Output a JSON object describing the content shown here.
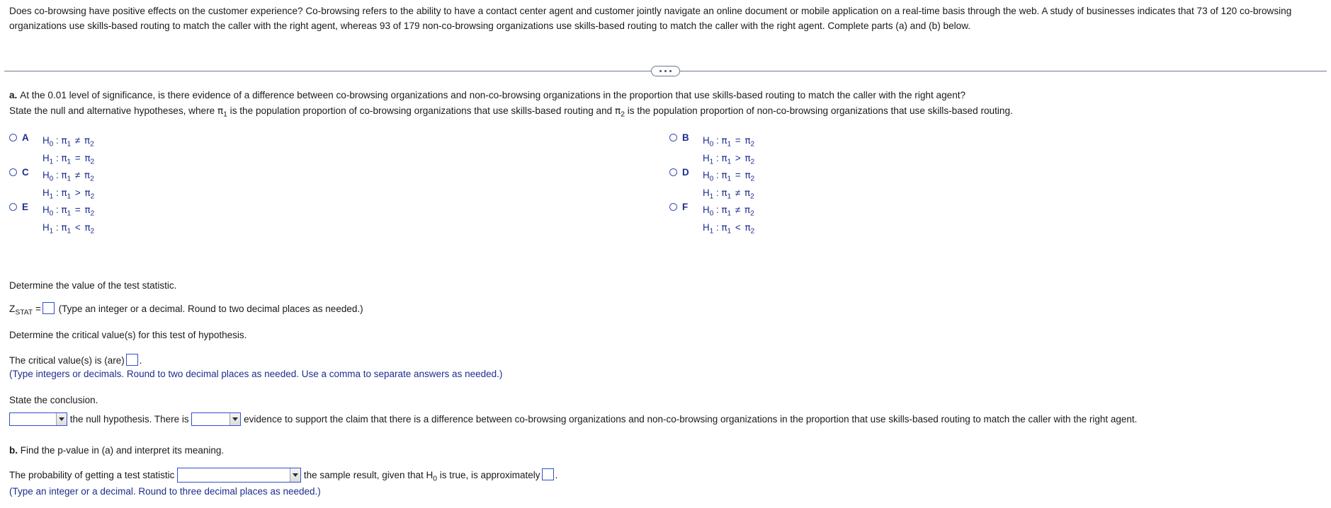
{
  "problem": {
    "text": "Does co-browsing have positive effects on the customer experience? Co-browsing refers to the ability to have a contact center agent and customer jointly navigate an online document or mobile application on a real-time basis through the web. A study of businesses indicates that 73 of 120 co-browsing organizations use skills-based routing to match the caller with the right agent, whereas 93 of 179 non-co-browsing organizations use skills-based routing to match the caller with the right agent. Complete parts (a) and (b) below.",
    "stats": {
      "cobrowsing_successes": 73,
      "cobrowsing_total": 120,
      "noncobrowsing_successes": 93,
      "noncobrowsing_total": 179
    }
  },
  "divider": {
    "ellipsis_label": "more-options"
  },
  "part_a": {
    "label": "a.",
    "question": "At the 0.01 level of significance, is there evidence of a difference between co-browsing organizations and non-co-browsing organizations in the proportion that use skills-based routing to match the caller with the right agent?",
    "instruction_pre": "State the null and alternative hypotheses, where ",
    "pi1": "π",
    "pi1_sub": "1",
    "instruction_mid": " is the population proportion of co-browsing organizations that use skills-based routing and ",
    "pi2": "π",
    "pi2_sub": "2",
    "instruction_post": " is the population proportion of non-co-browsing organizations that use skills-based routing.",
    "significance_level": "0.01"
  },
  "options": [
    {
      "key": "A",
      "h0_name": "H",
      "h0_sub": "0",
      "h0_rel": "≠",
      "h1_name": "H",
      "h1_sub": "1",
      "h1_rel": "=",
      "selected": false
    },
    {
      "key": "B",
      "h0_name": "H",
      "h0_sub": "0",
      "h0_rel": "=",
      "h1_name": "H",
      "h1_sub": "1",
      "h1_rel": ">",
      "selected": false
    },
    {
      "key": "C",
      "h0_name": "H",
      "h0_sub": "0",
      "h0_rel": "≠",
      "h1_name": "H",
      "h1_sub": "1",
      "h1_rel": ">",
      "selected": false
    },
    {
      "key": "D",
      "h0_name": "H",
      "h0_sub": "0",
      "h0_rel": "=",
      "h1_name": "H",
      "h1_sub": "1",
      "h1_rel": "≠",
      "selected": false
    },
    {
      "key": "E",
      "h0_name": "H",
      "h0_sub": "0",
      "h0_rel": "=",
      "h1_name": "H",
      "h1_sub": "1",
      "h1_rel": "<",
      "selected": false
    },
    {
      "key": "F",
      "h0_name": "H",
      "h0_sub": "0",
      "h0_rel": "≠",
      "h1_name": "H",
      "h1_sub": "1",
      "h1_rel": "<",
      "selected": false
    }
  ],
  "pi_symbol": "π",
  "test_statistic": {
    "prompt": "Determine the value of the test statistic.",
    "label_main": "Z",
    "label_sub": "STAT",
    "equals": "=",
    "value": "",
    "note": "(Type an integer or a decimal. Round to two decimal places as needed.)"
  },
  "critical_value": {
    "prompt": "Determine the critical value(s) for this test of hypothesis.",
    "sentence_pre": "The critical value(s) is (are)",
    "value": "",
    "sentence_post": ".",
    "note": "(Type integers or decimals. Round to two decimal places as needed. Use a comma to separate answers as needed.)"
  },
  "conclusion": {
    "prompt": "State the conclusion.",
    "decision_value": "",
    "text_mid": "the null hypothesis. There is",
    "evidence_value": "",
    "text_end": "evidence to support the claim that there is a difference between co-browsing organizations and non-co-browsing organizations in the proportion that use skills-based routing to match the caller with the right agent."
  },
  "part_b": {
    "label": "b.",
    "question": "Find the p-value in (a) and interpret its meaning.",
    "sentence_pre": "The probability of getting a test statistic",
    "dropdown_value": "",
    "sentence_mid": "the sample result, given that H",
    "h0_sub": "0",
    "sentence_mid2": " is true, is approximately",
    "value": "",
    "sentence_post": ".",
    "note": "(Type an integer or a decimal. Round to three decimal places as needed.)"
  },
  "colors": {
    "text": "#1a1a1a",
    "blue": "#1d2d8f",
    "field_border": "#2f4fcf",
    "divider": "#6b7a8f"
  }
}
